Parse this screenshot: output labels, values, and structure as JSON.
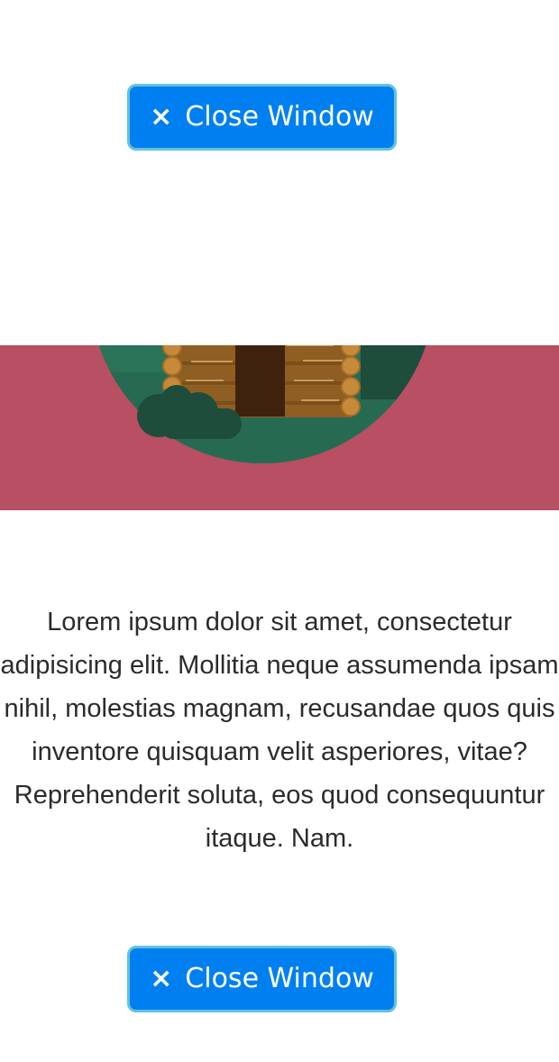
{
  "buttons": {
    "close_top_label": "Close Window",
    "close_bottom_label": "Close Window",
    "close_icon": "×"
  },
  "content": {
    "lines": [
      "Lorem ipsum dolor sit amet, consectetur",
      "adipisicing elit. Mollitia neque assumenda ipsam",
      "nihil, molestias magnam, recusandae quos quis",
      "inventore quisquam velit asperiores, vitae?",
      "Reprehenderit soluta, eos quod consequuntur",
      "itaque. Nam."
    ]
  },
  "colors": {
    "button_bg": "#0080f0",
    "button_border": "#62c2dc",
    "banner_bg": "#b84f63",
    "circle_green": "#2a7358",
    "dark_green": "#1e4d3c",
    "log_brown": "#8a5a1c",
    "door_brown": "#3e220e"
  },
  "icons": {
    "close": "close-x-icon",
    "illustration": "log-cabin-illustration"
  }
}
